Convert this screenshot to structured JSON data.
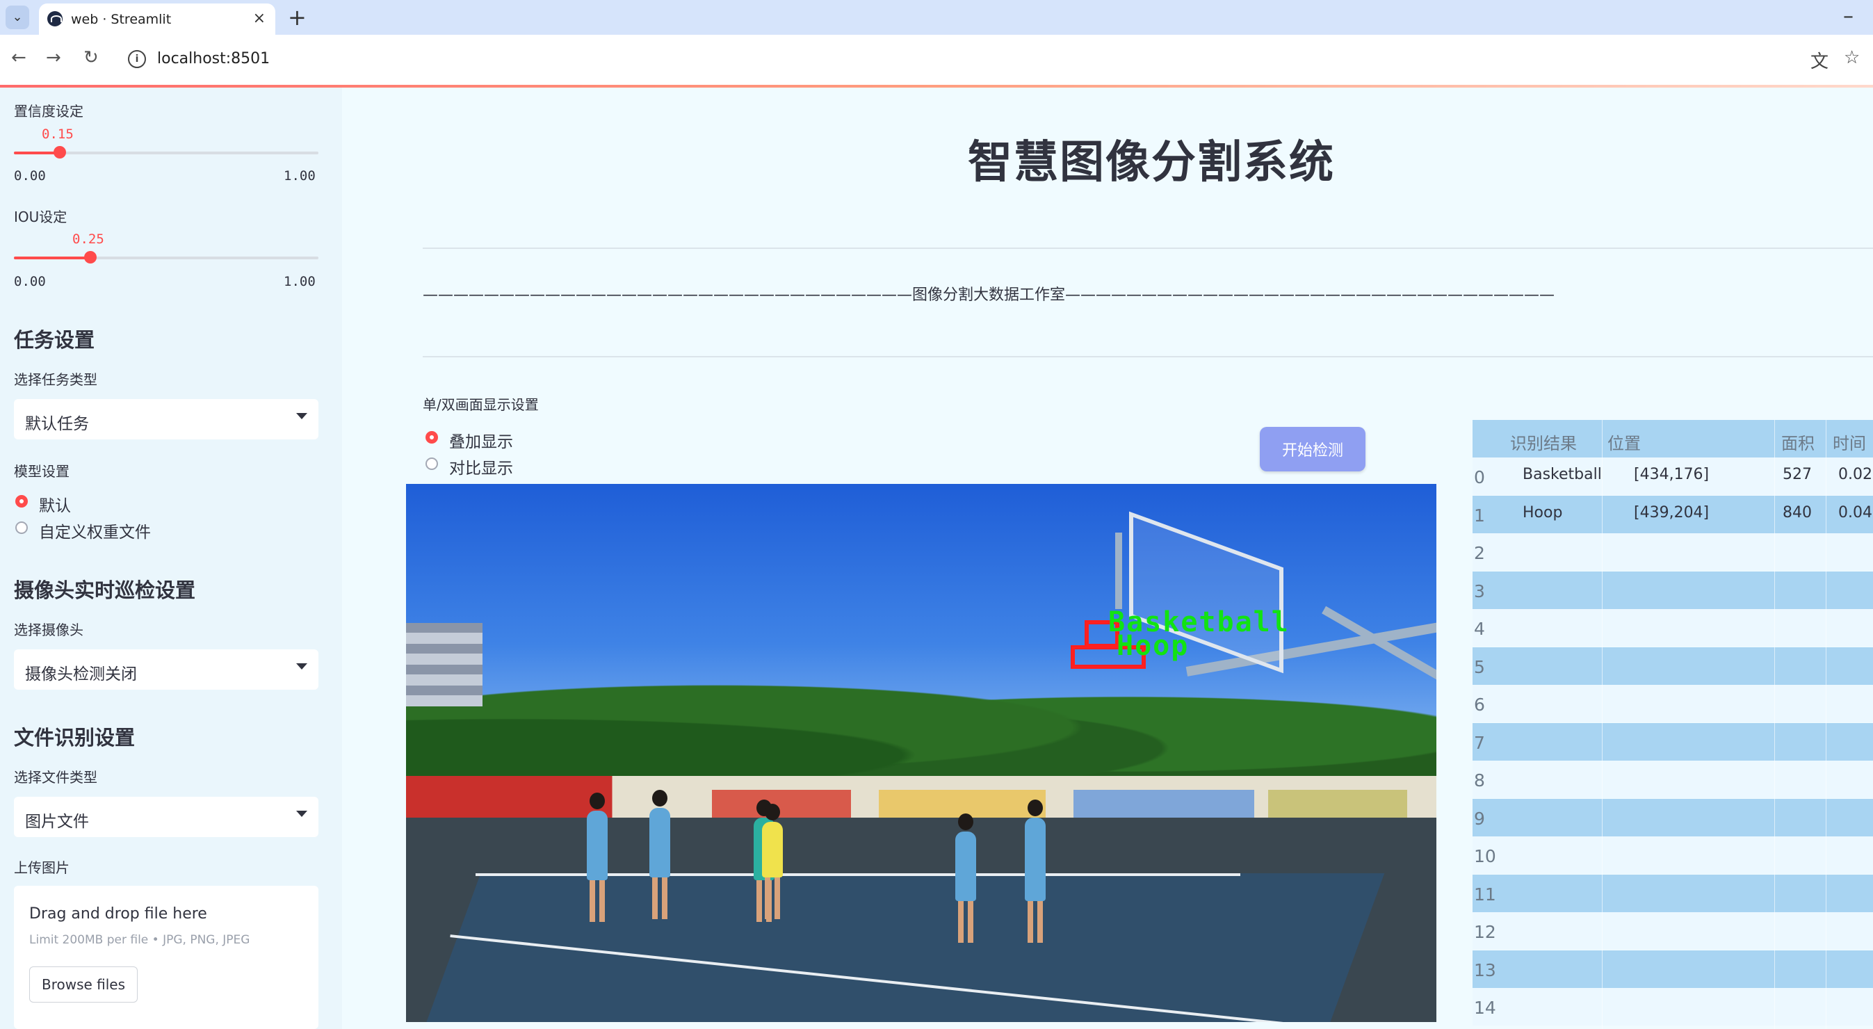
{
  "browser": {
    "tab_title": "web · Streamlit",
    "url": "localhost:8501"
  },
  "sidebar": {
    "confidence": {
      "label": "置信度设定",
      "value": "0.15",
      "min": "0.00",
      "max": "1.00",
      "fraction": 0.15
    },
    "iou": {
      "label": "IOU设定",
      "value": "0.25",
      "min": "0.00",
      "max": "1.00",
      "fraction": 0.25
    },
    "task": {
      "heading": "任务设置",
      "select_label": "选择任务类型",
      "selected": "默认任务"
    },
    "model": {
      "label": "模型设置",
      "options": [
        "默认",
        "自定义权重文件"
      ],
      "selected_index": 0
    },
    "camera": {
      "heading": "摄像头实时巡检设置",
      "select_label": "选择摄像头",
      "selected": "摄像头检测关闭"
    },
    "file": {
      "heading": "文件识别设置",
      "select_label": "选择文件类型",
      "selected": "图片文件"
    },
    "upload": {
      "label": "上传图片",
      "title": "Drag and drop file here",
      "limit": "Limit 200MB per file • JPG, PNG, JPEG",
      "button": "Browse files"
    }
  },
  "main": {
    "title": "智慧图像分割系统",
    "studio_line": "————————————————————————————————图像分割大数据工作室————————————————————————————————",
    "display": {
      "label": "单/双画面显示设置",
      "options": [
        "叠加显示",
        "对比显示"
      ],
      "selected_index": 0
    },
    "start_button": "开始检测",
    "detections": [
      {
        "label": "Basketball"
      },
      {
        "label": "Hoop"
      }
    ]
  },
  "table": {
    "headers": [
      "识别结果",
      "位置",
      "面积",
      "时间"
    ],
    "rows": [
      {
        "idx": "0",
        "result": "Basketball",
        "pos": "[434,176]",
        "area": "527",
        "time": "0.02"
      },
      {
        "idx": "1",
        "result": "Hoop",
        "pos": "[439,204]",
        "area": "840",
        "time": "0.04"
      },
      {
        "idx": "2"
      },
      {
        "idx": "3"
      },
      {
        "idx": "4"
      },
      {
        "idx": "5"
      },
      {
        "idx": "6"
      },
      {
        "idx": "7"
      },
      {
        "idx": "8"
      },
      {
        "idx": "9"
      },
      {
        "idx": "10"
      },
      {
        "idx": "11"
      },
      {
        "idx": "12"
      },
      {
        "idx": "13"
      },
      {
        "idx": "14"
      }
    ]
  },
  "colors": {
    "accent": "#ff4b4b",
    "button": "#8f9ff2",
    "table_stripe": "#a8d4f2",
    "detect_box": "#ff2020",
    "detect_text": "#12e312"
  },
  "icons": [
    "chevron-down-icon",
    "streamlit-icon",
    "close-icon",
    "plus-icon",
    "minimize-icon",
    "back-icon",
    "forward-icon",
    "reload-icon",
    "info-icon",
    "translate-icon",
    "star-icon"
  ]
}
